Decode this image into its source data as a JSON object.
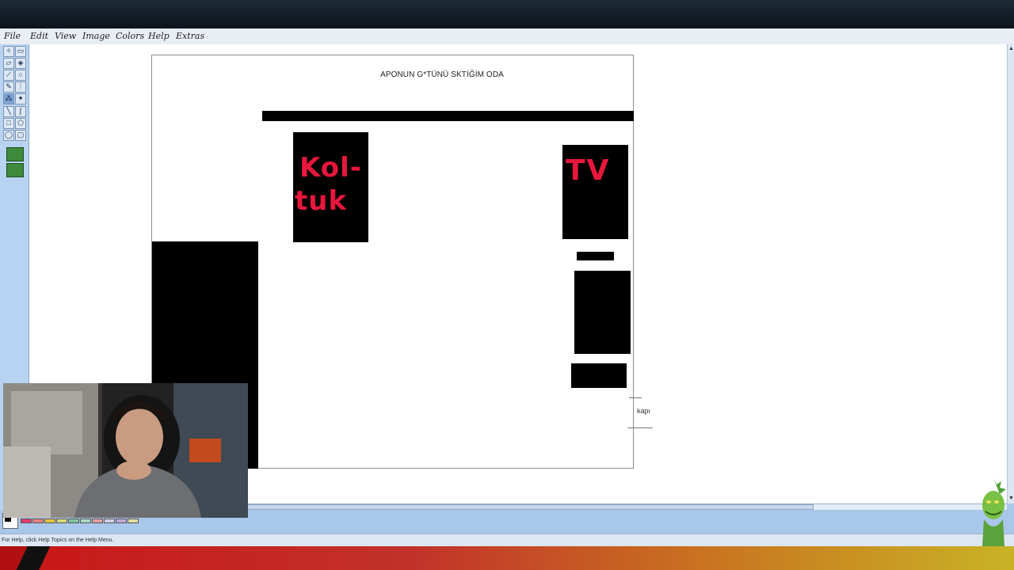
{
  "menu": [
    "File",
    "Edit",
    "View",
    "Image",
    "Colors",
    "Help",
    "Extras"
  ],
  "drawing": {
    "title": "APONUN G*TÜNÜ SKTİĞİM ODA",
    "koltuk_line1": "Kol-",
    "koltuk_line2": "tuk",
    "tv_label": "TV",
    "door_label": "kapı"
  },
  "status": {
    "help_text": "For Help, click Help Topics on the Help Menu."
  },
  "palette": {
    "foreground": "#000000",
    "background": "#ffffff",
    "colors": [
      "#000000",
      "#ffffff",
      "#808080",
      "#c0c0c0",
      "#6ee0e0",
      "#3bc8d8",
      "#2aa8d8",
      "#48c8c8",
      "#e070a8",
      "#f0a0c8",
      "#e83c6c",
      "#f08080",
      "#e8c040",
      "#d8d878",
      "#80c8a0",
      "#a8d8c0",
      "#e8a0a0",
      "#d0d0e8",
      "#c0a8d8",
      "#e0e0a0"
    ]
  },
  "colors": {
    "app_bg": "#a9c7ea",
    "ink_red": "#e8173c"
  },
  "icons": [
    "select-icon",
    "rect-select-icon",
    "eraser-icon",
    "fill-icon",
    "picker-icon",
    "magnifier-icon",
    "pencil-icon",
    "brush-icon",
    "airbrush-icon",
    "text-icon",
    "line-icon",
    "curve-icon",
    "rectangle-icon",
    "polygon-icon",
    "ellipse-icon",
    "rounded-rect-icon"
  ]
}
